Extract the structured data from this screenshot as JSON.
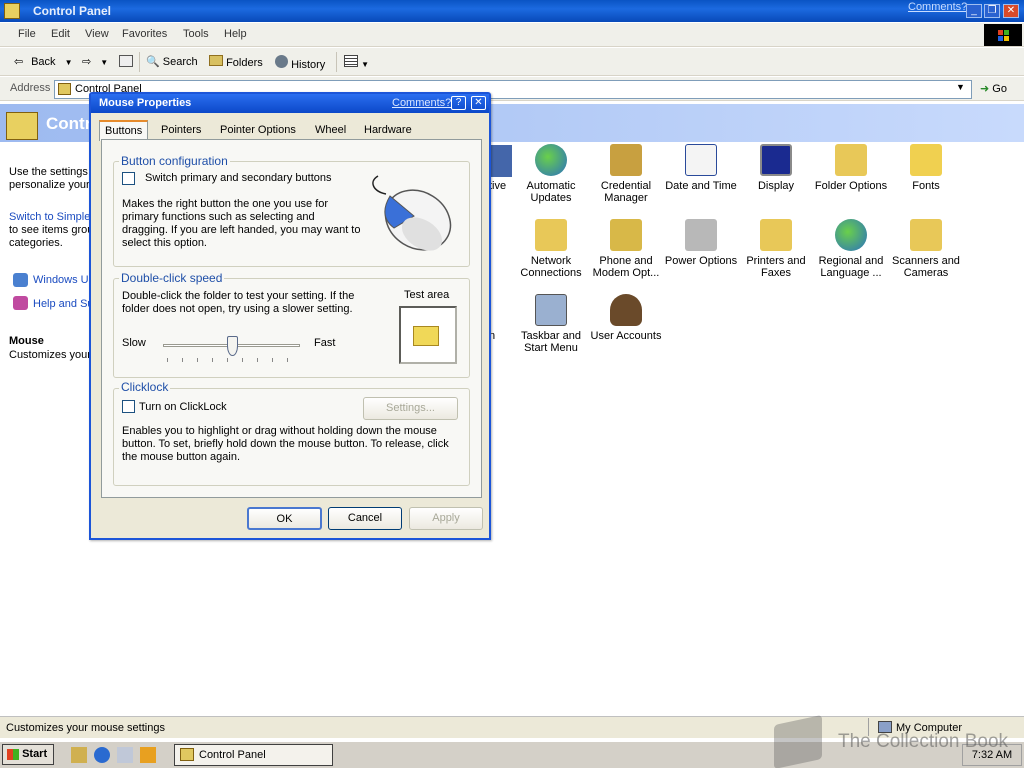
{
  "window": {
    "title": "Control Panel",
    "comments_link": "Comments?",
    "controls": {
      "minimize": "_",
      "restore": "❐",
      "close": "✕"
    }
  },
  "menubar": [
    "File",
    "Edit",
    "View",
    "Favorites",
    "Tools",
    "Help"
  ],
  "toolbar": {
    "back": "Back",
    "search": "Search",
    "folders": "Folders",
    "history": "History"
  },
  "address": {
    "label": "Address",
    "value": "Control Panel",
    "go": "Go"
  },
  "panel": {
    "title": "Contr"
  },
  "leftpane": {
    "intro_line1": "Use the settings",
    "intro_line2": "personalize your",
    "switch_link": "Switch to Simple",
    "switch_line2": "to see items grou",
    "switch_line3": "categories.",
    "windows_update": "Windows Up",
    "help_support": "Help and Su",
    "selected_title": "Mouse",
    "selected_desc": "Customizes your"
  },
  "icons": [
    {
      "label": "tive"
    },
    {
      "label": "Automatic Updates"
    },
    {
      "label": "Credential Manager"
    },
    {
      "label": "Date and Time"
    },
    {
      "label": "Display"
    },
    {
      "label": "Folder Options"
    },
    {
      "label": "Fonts"
    },
    {
      "label": "Network Connections"
    },
    {
      "label": "Phone and Modem Opt..."
    },
    {
      "label": "Power Options"
    },
    {
      "label": "Printers and Faxes"
    },
    {
      "label": "Regional and Language ..."
    },
    {
      "label": "Scanners and Cameras"
    },
    {
      "label": "n"
    },
    {
      "label": "Taskbar and Start Menu"
    },
    {
      "label": "User Accounts"
    }
  ],
  "dialog": {
    "title": "Mouse Properties",
    "comments": "Comments?",
    "help": "?",
    "close": "✕",
    "tabs": [
      "Buttons",
      "Pointers",
      "Pointer Options",
      "Wheel",
      "Hardware"
    ],
    "button_config": {
      "label": "Button configuration",
      "checkbox": "Switch primary and secondary buttons",
      "desc": "Makes the right button the one you use for primary functions such as selecting and dragging. If you are left handed, you may want to select this option."
    },
    "dblclick": {
      "label": "Double-click speed",
      "desc": "Double-click the folder to test your setting.  If the folder does not open, try using a slower setting.",
      "test_area": "Test area",
      "slow": "Slow",
      "fast": "Fast",
      "speed_fraction": 0.5
    },
    "clicklock": {
      "label": "Clicklock",
      "checkbox": "Turn on ClickLock",
      "settings": "Settings...",
      "desc": "Enables you to highlight or drag without holding down the mouse button.  To set, briefly hold down the mouse button.  To release, click the mouse button again."
    },
    "buttons": {
      "ok": "OK",
      "cancel": "Cancel",
      "apply": "Apply"
    }
  },
  "statusbar": {
    "text": "Customizes your mouse settings",
    "zone": "My Computer"
  },
  "taskbar": {
    "start": "Start",
    "task": "Control Panel",
    "clock": "7:32 AM"
  },
  "watermark": "The Collection Book"
}
